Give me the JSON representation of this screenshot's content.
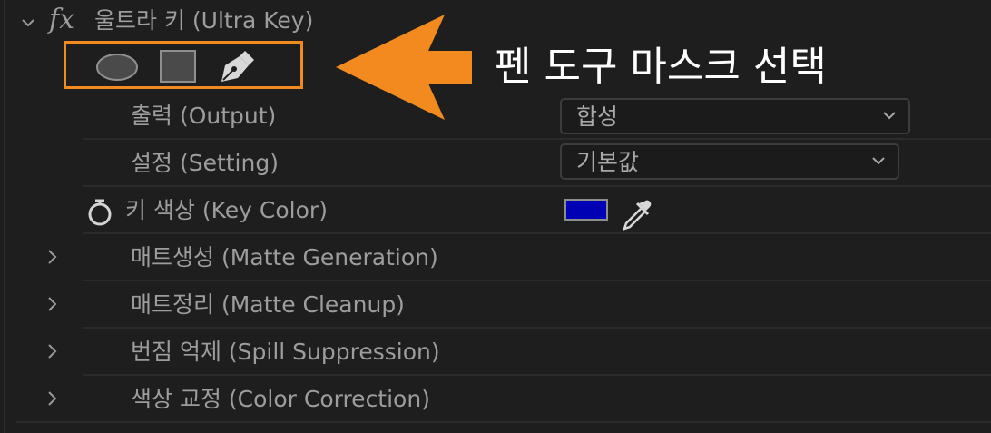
{
  "effect": {
    "fx_symbol": "fx",
    "title": "울트라 키 (Ultra Key)"
  },
  "mask_tools": {
    "icons": [
      "ellipse-mask-icon",
      "rectangle-mask-icon",
      "pen-mask-icon"
    ],
    "highlight_color": "#f38a1f"
  },
  "annotation": {
    "text": "펜 도구 마스크 선택",
    "color": "#ffffff",
    "arrow_color": "#f38a1f"
  },
  "properties": {
    "output": {
      "label": "출력 (Output)",
      "value": "합성"
    },
    "setting": {
      "label": "설정 (Setting)",
      "value": "기본값"
    },
    "key_color": {
      "label": "키 색상 (Key Color)",
      "swatch_color": "#0000b4"
    }
  },
  "groups": [
    {
      "label": "매트생성 (Matte Generation)"
    },
    {
      "label": "매트정리 (Matte Cleanup)"
    },
    {
      "label": "번짐 억제 (Spill Suppression)"
    },
    {
      "label": "색상 교정 (Color Correction)"
    }
  ],
  "icons": {
    "collapse": "chevron-down-icon",
    "expand": "chevron-right-icon",
    "stopwatch": "stopwatch-icon",
    "eyedropper": "eyedropper-icon",
    "dropdown": "chevron-down-icon"
  }
}
